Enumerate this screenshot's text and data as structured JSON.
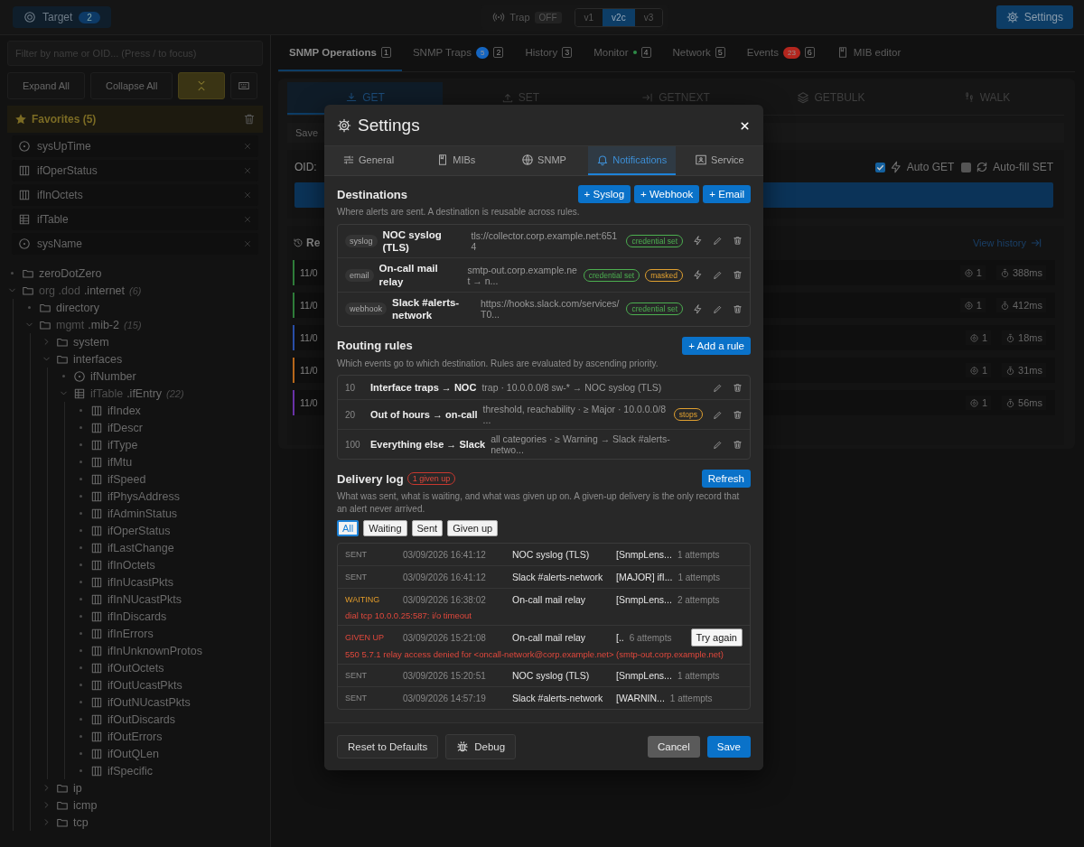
{
  "topbar": {
    "target": {
      "label": "Target",
      "count": "2"
    },
    "trap": {
      "label": "Trap",
      "state": "OFF"
    },
    "versions": [
      {
        "label": "v1",
        "selected": false
      },
      {
        "label": "v2c",
        "selected": true
      },
      {
        "label": "v3",
        "selected": false
      }
    ],
    "settings": "Settings"
  },
  "sidebar": {
    "filter_placeholder": "Filter by name or OID... (Press / to focus)",
    "buttons": [
      "Expand All",
      "Collapse All"
    ],
    "favorites": {
      "title": "Favorites (5)",
      "items": [
        {
          "name": "sysUpTime",
          "kind": "scalar"
        },
        {
          "name": "ifOperStatus",
          "kind": "column"
        },
        {
          "name": "ifInOctets",
          "kind": "column"
        },
        {
          "name": "ifTable",
          "kind": "table"
        },
        {
          "name": "sysName",
          "kind": "scalar"
        }
      ]
    },
    "tree": [
      {
        "label": "zeroDotZero",
        "kind": "folder"
      },
      {
        "path": "org .dod",
        "label": ".internet",
        "count": "(6)",
        "kind": "folder",
        "expanded": true,
        "children": [
          {
            "label": "directory",
            "kind": "folder"
          },
          {
            "path": "mgmt",
            "label": ".mib-2",
            "count": "(15)",
            "kind": "folder",
            "expanded": true,
            "children": [
              {
                "label": "system",
                "kind": "folder",
                "expanded": false
              },
              {
                "label": "interfaces",
                "kind": "folder",
                "expanded": true,
                "children": [
                  {
                    "label": "ifNumber",
                    "kind": "scalar"
                  },
                  {
                    "path": "ifTable",
                    "label": ".ifEntry",
                    "count": "(22)",
                    "kind": "table",
                    "expanded": true,
                    "children": [
                      {
                        "label": "ifIndex",
                        "kind": "column"
                      },
                      {
                        "label": "ifDescr",
                        "kind": "column"
                      },
                      {
                        "label": "ifType",
                        "kind": "column"
                      },
                      {
                        "label": "ifMtu",
                        "kind": "column"
                      },
                      {
                        "label": "ifSpeed",
                        "kind": "column"
                      },
                      {
                        "label": "ifPhysAddress",
                        "kind": "column"
                      },
                      {
                        "label": "ifAdminStatus",
                        "kind": "column"
                      },
                      {
                        "label": "ifOperStatus",
                        "kind": "column"
                      },
                      {
                        "label": "ifLastChange",
                        "kind": "column"
                      },
                      {
                        "label": "ifInOctets",
                        "kind": "column"
                      },
                      {
                        "label": "ifInUcastPkts",
                        "kind": "column"
                      },
                      {
                        "label": "ifInNUcastPkts",
                        "kind": "column"
                      },
                      {
                        "label": "ifInDiscards",
                        "kind": "column"
                      },
                      {
                        "label": "ifInErrors",
                        "kind": "column"
                      },
                      {
                        "label": "ifInUnknownProtos",
                        "kind": "column"
                      },
                      {
                        "label": "ifOutOctets",
                        "kind": "column"
                      },
                      {
                        "label": "ifOutUcastPkts",
                        "kind": "column"
                      },
                      {
                        "label": "ifOutNUcastPkts",
                        "kind": "column"
                      },
                      {
                        "label": "ifOutDiscards",
                        "kind": "column"
                      },
                      {
                        "label": "ifOutErrors",
                        "kind": "column"
                      },
                      {
                        "label": "ifOutQLen",
                        "kind": "column"
                      },
                      {
                        "label": "ifSpecific",
                        "kind": "column"
                      }
                    ]
                  }
                ]
              },
              {
                "label": "ip",
                "kind": "folder",
                "expanded": false
              },
              {
                "label": "icmp",
                "kind": "folder",
                "expanded": false
              },
              {
                "label": "tcp",
                "kind": "folder",
                "expanded": false
              }
            ]
          }
        ]
      }
    ]
  },
  "tabs": [
    {
      "label": "SNMP Operations",
      "kind": "tab",
      "key": "1",
      "selected": true
    },
    {
      "label": "SNMP Traps",
      "kind": "tab",
      "badge": {
        "text": "5",
        "color": "#1565c0"
      },
      "key": "2",
      "selected": false
    },
    {
      "label": "History",
      "kind": "tab",
      "key": "3",
      "selected": false
    },
    {
      "label": "Monitor",
      "kind": "tab",
      "dot": {
        "color": "#2e8b47"
      },
      "key": "4",
      "selected": false
    },
    {
      "label": "Network",
      "kind": "tab",
      "key": "5",
      "selected": false
    },
    {
      "label": "Events",
      "kind": "tab",
      "badge": {
        "text": "23",
        "color": "#b3261e"
      },
      "key": "6",
      "selected": false
    },
    {
      "label": "MIB editor",
      "kind": "editor",
      "selected": false
    }
  ],
  "operations": {
    "tabs": [
      {
        "label": "GET",
        "kind": "get",
        "selected": true
      },
      {
        "label": "SET",
        "kind": "set",
        "selected": false
      },
      {
        "label": "GETNEXT",
        "kind": "getnext",
        "selected": false
      },
      {
        "label": "GETBULK",
        "kind": "getbulk",
        "selected": false
      },
      {
        "label": "WALK",
        "kind": "walk",
        "selected": false
      }
    ],
    "saved": "Save",
    "oid_label": "OID:",
    "options": [
      {
        "label": "Auto GET",
        "kind": "bolt",
        "checked": true
      },
      {
        "label": "Auto-fill SET",
        "kind": "refresh",
        "checked": false
      }
    ]
  },
  "recent": {
    "title": "Re",
    "link": "View history",
    "rows": [
      {
        "date": "11/0",
        "color": "#2f7d3a",
        "count": "1",
        "duration": "388ms"
      },
      {
        "date": "11/0",
        "color": "#2f7d3a",
        "count": "1",
        "duration": "412ms"
      },
      {
        "date": "11/0",
        "color": "#2a4fa8",
        "count": "1",
        "duration": "18ms"
      },
      {
        "date": "11/0",
        "color": "#b8681c",
        "count": "1",
        "duration": "31ms"
      },
      {
        "date": "11/0",
        "color": "#6a33a8",
        "count": "1",
        "duration": "56ms"
      }
    ]
  },
  "modal": {
    "title": "Settings",
    "tabs": [
      {
        "label": "General",
        "kind": "general",
        "selected": false
      },
      {
        "label": "MIBs",
        "kind": "mibs",
        "selected": false
      },
      {
        "label": "SNMP",
        "kind": "snmp",
        "selected": false
      },
      {
        "label": "Notifications",
        "kind": "notifications",
        "selected": true
      },
      {
        "label": "Service",
        "kind": "service",
        "selected": false
      }
    ],
    "destinations": {
      "title": "Destinations",
      "hint": "Where alerts are sent. A destination is reusable across rules.",
      "buttons": [
        "+ Syslog",
        "+ Webhook",
        "+ Email"
      ],
      "rows": [
        {
          "type": "syslog",
          "name": "NOC syslog (TLS)",
          "address": "tls://collector.corp.example.net:6514",
          "badges": [
            {
              "text": "credential set",
              "color": "#4caf50"
            }
          ]
        },
        {
          "type": "email",
          "name": "On-call mail relay",
          "address": "smtp-out.corp.example.net → n...",
          "badges": [
            {
              "text": "credential set",
              "color": "#4caf50"
            },
            {
              "text": "masked",
              "color": "#e0a030"
            }
          ]
        },
        {
          "type": "webhook",
          "name": "Slack #alerts-network",
          "address": "https://hooks.slack.com/services/T0...",
          "badges": [
            {
              "text": "credential set",
              "color": "#4caf50"
            }
          ]
        }
      ]
    },
    "rules": {
      "title": "Routing rules",
      "button": "+ Add a rule",
      "hint": "Which events go to which destination. Rules are evaluated by ascending priority.",
      "rows": [
        {
          "priority": "10",
          "name": "Interface traps → NOC",
          "summary": "trap · 10.0.0.0/8 sw-* → NOC syslog (TLS)"
        },
        {
          "priority": "20",
          "name": "Out of hours → on-call",
          "summary": "threshold, reachability · ≥ Major · 10.0.0.0/8 ...",
          "badge": "stops"
        },
        {
          "priority": "100",
          "name": "Everything else → Slack",
          "summary": "all categories · ≥ Warning → Slack #alerts-netwo..."
        }
      ]
    },
    "log": {
      "title": "Delivery log",
      "badge": "1 given up",
      "button": "Refresh",
      "hint": "What was sent, what is waiting, and what was given up on. A given-up delivery is the only record that an alert never arrived.",
      "filters": [
        {
          "label": "All",
          "selected": true
        },
        {
          "label": "Waiting",
          "selected": false
        },
        {
          "label": "Sent",
          "selected": false
        },
        {
          "label": "Given up",
          "selected": false
        }
      ],
      "rows": [
        {
          "kind": "sent",
          "status": "SENT",
          "time": "03/09/2026 16:41:12",
          "destination": "NOC syslog (TLS)",
          "message": "[SnmpLens...",
          "attempts": "1 attempts"
        },
        {
          "kind": "sent",
          "status": "SENT",
          "time": "03/09/2026 16:41:12",
          "destination": "Slack #alerts-network",
          "message": "[MAJOR] ifI...",
          "attempts": "1 attempts"
        },
        {
          "kind": "waiting",
          "status": "WAITING",
          "time": "03/09/2026 16:38:02",
          "destination": "On-call mail relay",
          "message": "[SnmpLens...",
          "attempts": "2 attempts",
          "error": "dial tcp 10.0.0.25:587: i/o timeout"
        },
        {
          "kind": "given_up",
          "status": "GIVEN UP",
          "time": "03/09/2026 15:21:08",
          "destination": "On-call mail relay",
          "message": "[..",
          "attempts": "6 attempts",
          "action": "Try again",
          "error": "550 5.7.1 relay access denied for <oncall-network@corp.example.net> (smtp-out.corp.example.net)"
        },
        {
          "kind": "sent",
          "status": "SENT",
          "time": "03/09/2026 15:20:51",
          "destination": "NOC syslog (TLS)",
          "message": "[SnmpLens...",
          "attempts": "1 attempts"
        },
        {
          "kind": "sent",
          "status": "SENT",
          "time": "03/09/2026 14:57:19",
          "destination": "Slack #alerts-network",
          "message": "[WARNIN...",
          "attempts": "1 attempts"
        }
      ]
    },
    "footer": {
      "reset": "Reset to Defaults",
      "debug": "Debug",
      "cancel": "Cancel",
      "save": "Save"
    }
  }
}
